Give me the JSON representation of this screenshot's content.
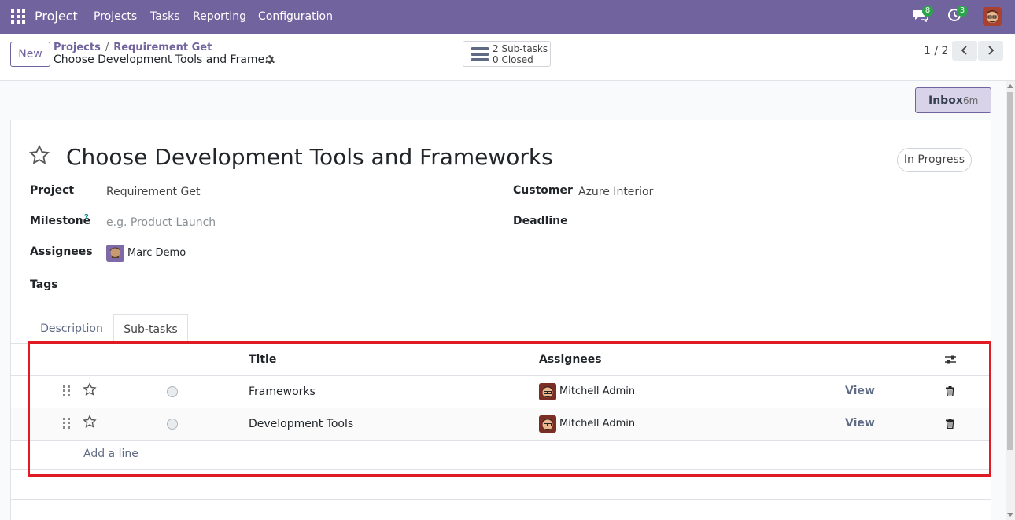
{
  "navbar": {
    "brand": "Project",
    "menus": [
      "Projects",
      "Tasks",
      "Reporting",
      "Configuration"
    ],
    "messages_count": "8",
    "activities_count": "3",
    "bg_color": "#71639e"
  },
  "control_panel": {
    "new_label": "New",
    "breadcrumb": {
      "root": "Projects",
      "separator": "/",
      "parent": "Requirement Get",
      "current": "Choose Development Tools and Frame…"
    },
    "subtasks_button": {
      "line1": "2 Sub-tasks",
      "line2": "0 Closed"
    },
    "pager": "1 / 2"
  },
  "inbox": {
    "label": "Inbox",
    "time": "6m"
  },
  "form": {
    "title": "Choose Development Tools and Frameworks",
    "stage": "In Progress",
    "fields": {
      "project_label": "Project",
      "project_value": "Requirement Get",
      "milestone_label": "Milestone",
      "milestone_help": "?",
      "milestone_placeholder": "e.g. Product Launch",
      "assignees_label": "Assignees",
      "assignees_value": "Marc Demo",
      "tags_label": "Tags",
      "customer_label": "Customer",
      "customer_value": "Azure Interior",
      "deadline_label": "Deadline"
    },
    "tabs": [
      "Description",
      "Sub-tasks"
    ],
    "active_tab": "Sub-tasks"
  },
  "subtasks": {
    "columns": {
      "title": "Title",
      "assignees": "Assignees"
    },
    "rows": [
      {
        "title": "Frameworks",
        "assignee": "Mitchell Admin",
        "action": "View"
      },
      {
        "title": "Development Tools",
        "assignee": "Mitchell Admin",
        "action": "View"
      }
    ],
    "add_line": "Add a line"
  },
  "colors": {
    "accent": "#71639e",
    "highlight": "#e01b24",
    "badge": "#2aa448"
  }
}
